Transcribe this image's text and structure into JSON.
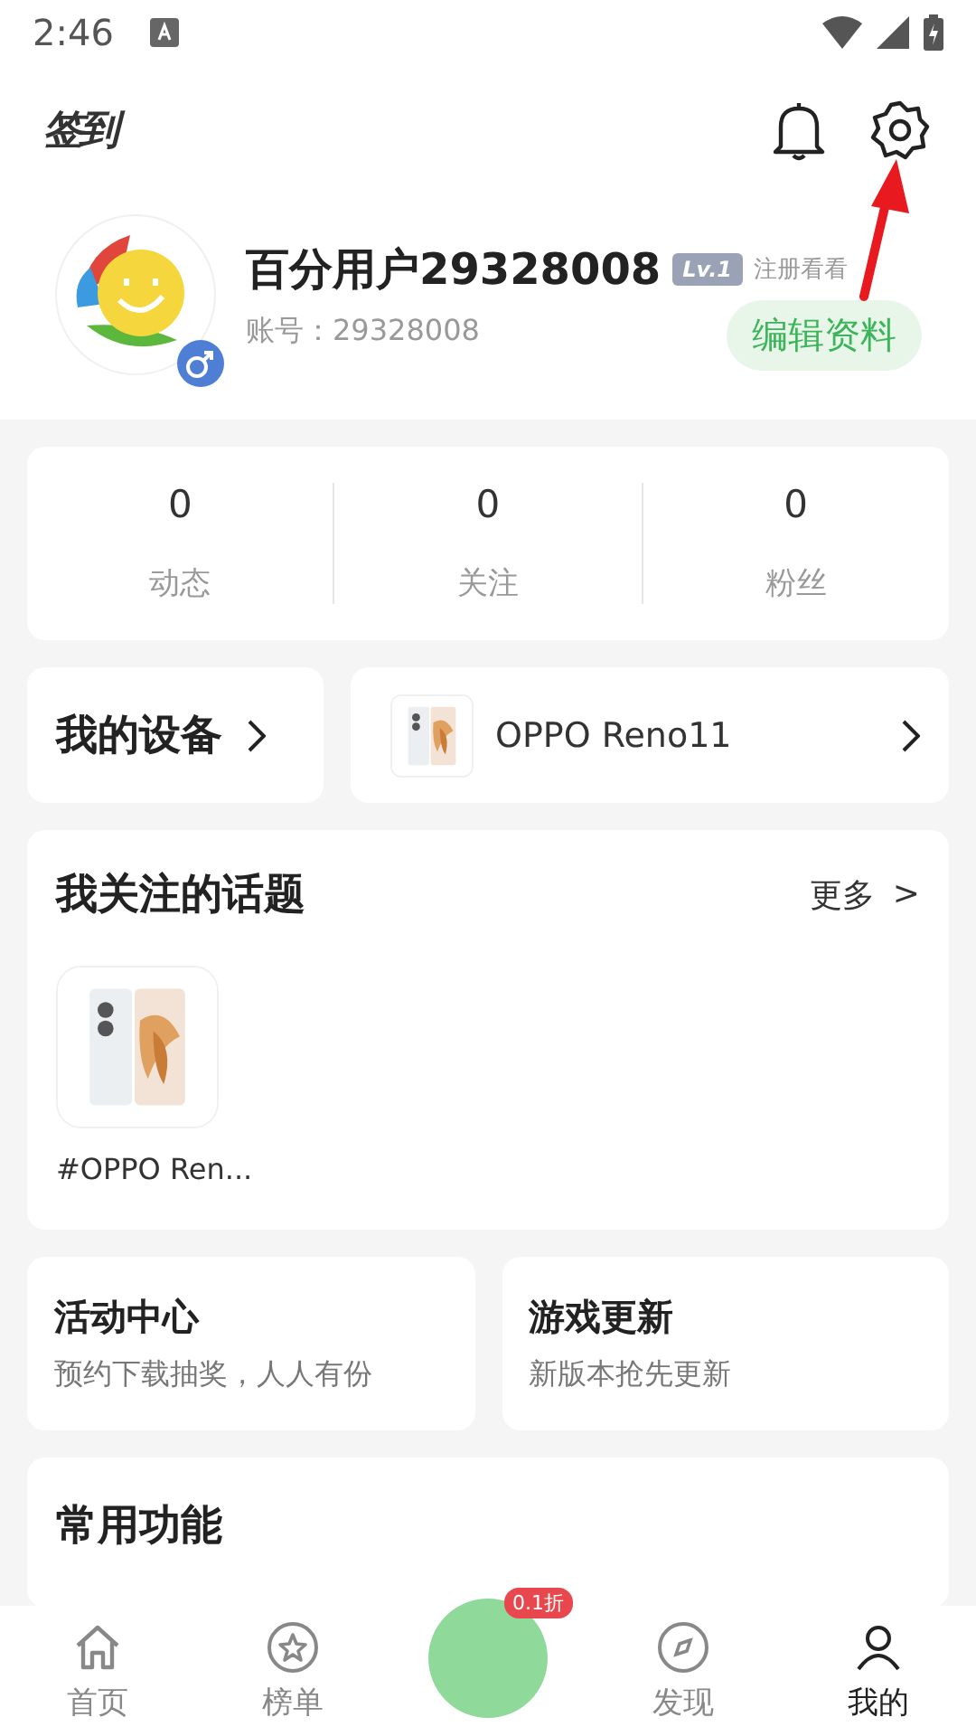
{
  "status_bar": {
    "time": "2:46"
  },
  "header": {
    "checkin": "签到"
  },
  "profile": {
    "name": "百分用户29328008",
    "level": "Lv.1",
    "level_hint": "注册看看",
    "account": "账号：29328008",
    "edit_button": "编辑资料"
  },
  "stats": [
    {
      "value": "0",
      "label": "动态"
    },
    {
      "value": "0",
      "label": "关注"
    },
    {
      "value": "0",
      "label": "粉丝"
    }
  ],
  "devices": {
    "title": "我的设备",
    "device": "OPPO Reno11"
  },
  "topics": {
    "title": "我关注的话题",
    "more": "更多",
    "more_arrow": ">",
    "items": [
      {
        "label": "#OPPO Ren..."
      }
    ]
  },
  "promos": [
    {
      "title": "活动中心",
      "subtitle": "预约下载抽奖，人人有份"
    },
    {
      "title": "游戏更新",
      "subtitle": "新版本抢先更新"
    }
  ],
  "common": {
    "title": "常用功能"
  },
  "nav": [
    {
      "kind": "home",
      "label": "首页",
      "selected": false
    },
    {
      "kind": "rank",
      "label": "榜单",
      "selected": false
    },
    {
      "kind": "center",
      "badge": "0.1折",
      "selected": false
    },
    {
      "kind": "discover",
      "label": "发现",
      "selected": false
    },
    {
      "kind": "me",
      "label": "我的",
      "selected": true
    }
  ]
}
